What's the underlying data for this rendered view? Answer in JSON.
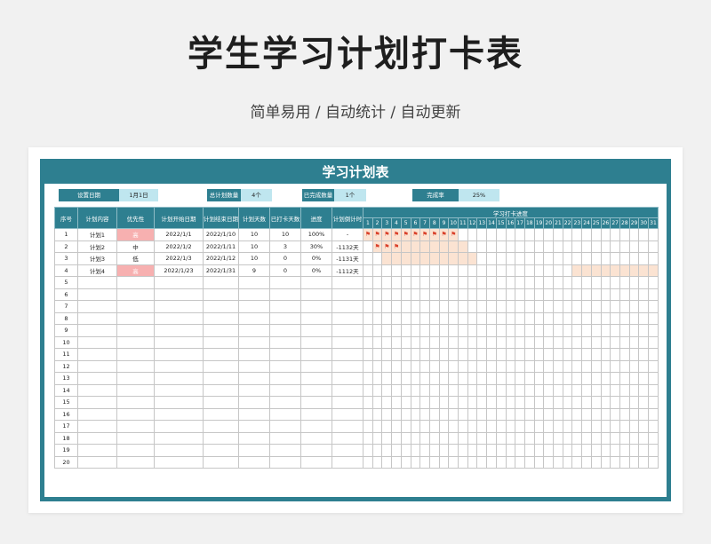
{
  "title": "学生学习计划打卡表",
  "subtitle": "简单易用 / 自动统计 / 自动更新",
  "sheet": {
    "title": "学习计划表",
    "summary": {
      "set_date_label": "设置日期",
      "set_date_value": "1月1日",
      "total_label": "总计划数量",
      "total_value": "4个",
      "done_label": "已完成数量",
      "done_value": "1个",
      "rate_label": "完成率",
      "rate_value": "25%"
    },
    "columns": [
      "序号",
      "计划内容",
      "优先性",
      "计划开始日期",
      "计划结束日期",
      "计划天数",
      "已打卡天数",
      "进度",
      "计划倒计时"
    ],
    "checkin_header": "学习打卡进度",
    "days": [
      "1",
      "2",
      "3",
      "4",
      "5",
      "6",
      "7",
      "8",
      "9",
      "10",
      "11",
      "12",
      "13",
      "14",
      "15",
      "16",
      "17",
      "18",
      "19",
      "20",
      "21",
      "22",
      "23",
      "24",
      "25",
      "26",
      "27",
      "28",
      "29",
      "30",
      "31"
    ],
    "rows": [
      {
        "no": "1",
        "content": "计划1",
        "priority": "高",
        "start": "2022/1/1",
        "end": "2022/1/10",
        "days": "10",
        "checked": "10",
        "progress": "100%",
        "countdown": "-",
        "span": [
          1,
          10
        ],
        "flags": [
          1,
          2,
          3,
          4,
          5,
          6,
          7,
          8,
          9,
          10
        ]
      },
      {
        "no": "2",
        "content": "计划2",
        "priority": "中",
        "start": "2022/1/2",
        "end": "2022/1/11",
        "days": "10",
        "checked": "3",
        "progress": "30%",
        "countdown": "-1132天",
        "span": [
          2,
          11
        ],
        "flags": [
          2,
          3,
          4
        ]
      },
      {
        "no": "3",
        "content": "计划3",
        "priority": "低",
        "start": "2022/1/3",
        "end": "2022/1/12",
        "days": "10",
        "checked": "0",
        "progress": "0%",
        "countdown": "-1131天",
        "span": [
          3,
          12
        ],
        "flags": []
      },
      {
        "no": "4",
        "content": "计划4",
        "priority": "高",
        "start": "2022/1/23",
        "end": "2022/1/31",
        "days": "9",
        "checked": "0",
        "progress": "0%",
        "countdown": "-1112天",
        "span": [
          23,
          31
        ],
        "flags": []
      },
      {
        "no": "5"
      },
      {
        "no": "6"
      },
      {
        "no": "7"
      },
      {
        "no": "8"
      },
      {
        "no": "9"
      },
      {
        "no": "10"
      },
      {
        "no": "11"
      },
      {
        "no": "12"
      },
      {
        "no": "13"
      },
      {
        "no": "14"
      },
      {
        "no": "15"
      },
      {
        "no": "16"
      },
      {
        "no": "17"
      },
      {
        "no": "18"
      },
      {
        "no": "19"
      },
      {
        "no": "20"
      }
    ],
    "colors": {
      "header": "#2e7f90",
      "high_priority": "#f7b0b0",
      "bar": "#fbe3d2",
      "flag": "#d9402a"
    },
    "flag_icon": "flag-icon"
  }
}
